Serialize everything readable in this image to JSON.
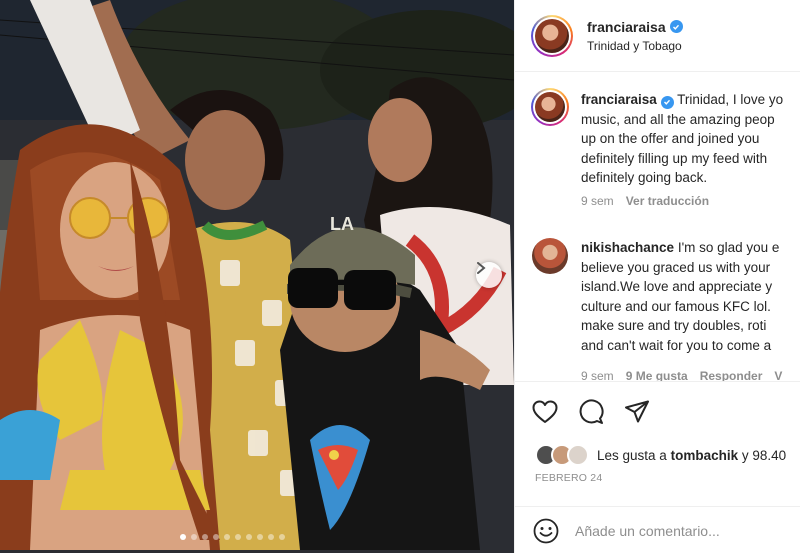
{
  "post": {
    "photo_alt": "",
    "carousel": {
      "count": 10,
      "active_index": 0
    }
  },
  "header": {
    "username": "franciaraisa",
    "location": "Trinidad y Tobago",
    "verified_icon": "verified-badge-icon"
  },
  "caption": {
    "username": "franciaraisa",
    "text_lines": [
      "Trinidad, I love yo",
      "music, and all the amazing peop",
      "up on the offer and joined you ",
      "definitely filling up my feed with",
      "definitely going back."
    ],
    "time": "9 sem",
    "translate": "Ver traducción"
  },
  "comment": {
    "username": "nikishachance",
    "text_lines": [
      "I'm so glad you e",
      "believe you graced us with your",
      "island.We love and appreciate y",
      "culture and our famous KFC lol.",
      "make sure and try doubles, roti",
      "and can't wait for you to come a"
    ],
    "time": "9 sem",
    "likes": "9 Me gusta",
    "reply": "Responder",
    "more": "V"
  },
  "actions": {
    "icons": [
      "heart-icon",
      "comment-icon",
      "share-icon"
    ]
  },
  "likes": {
    "prefix": "Les gusta a",
    "user": "tombachik",
    "suffix": "y 98.40"
  },
  "date": "FEBRERO 24",
  "comment_input": {
    "placeholder": "Añade un comentario..."
  },
  "colors": {
    "verified": "#3897f0",
    "muted": "#8e8e8e",
    "text": "#262626"
  }
}
